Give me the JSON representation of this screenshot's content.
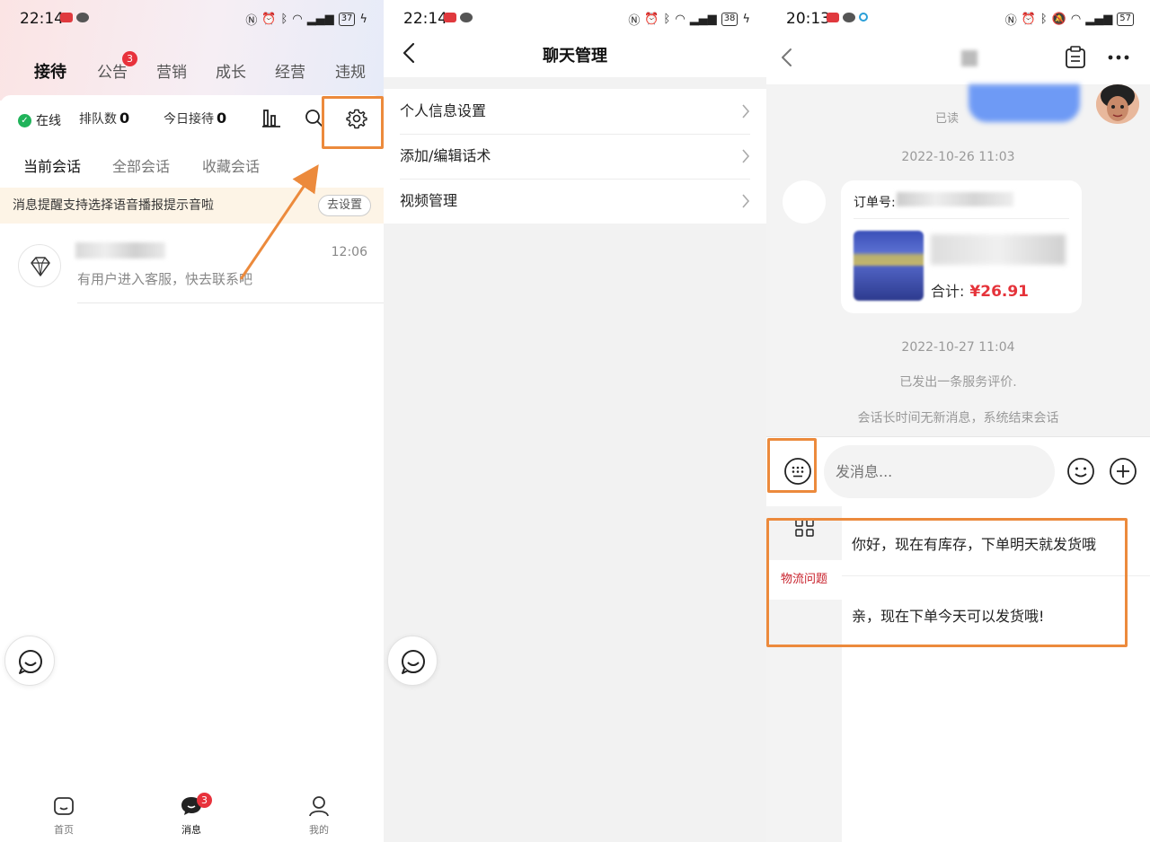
{
  "screen1": {
    "status": {
      "time": "22:14",
      "battery": "37"
    },
    "top_tabs": [
      {
        "label": "接待"
      },
      {
        "label": "公告",
        "badge": "3"
      },
      {
        "label": "营销"
      },
      {
        "label": "成长"
      },
      {
        "label": "经营"
      },
      {
        "label": "违规"
      }
    ],
    "online_label": "在线",
    "queue_label": "排队数",
    "queue_value": "0",
    "today_label": "今日接待",
    "today_value": "0",
    "sub_tabs": [
      "当前会话",
      "全部会话",
      "收藏会话"
    ],
    "notice": {
      "text": "消息提醒支持选择语音播报提示音啦",
      "button": "去设置"
    },
    "conversation": {
      "time": "12:06",
      "message": "有用户进入客服，快去联系吧"
    },
    "bottom_nav": [
      {
        "label": "首页",
        "icon": "home-icon"
      },
      {
        "label": "消息",
        "icon": "message-icon",
        "badge": "3"
      },
      {
        "label": "我的",
        "icon": "user-icon"
      }
    ]
  },
  "screen2": {
    "status": {
      "time": "22:14",
      "battery": "38"
    },
    "title": "聊天管理",
    "menu": [
      "个人信息设置",
      "添加/编辑话术",
      "视频管理"
    ]
  },
  "screen3": {
    "status": {
      "time": "20:13",
      "battery": "57"
    },
    "read_label": "已读",
    "timestamp1": "2022-10-26 11:03",
    "order_label": "订单号:",
    "order_total_label": "合计:",
    "order_total_value": "¥26.91",
    "timestamp2": "2022-10-27 11:04",
    "system_msg1": "已发出一条服务评价.",
    "system_msg2": "会话长时间无新消息，系统结束会话",
    "input_placeholder": "发消息...",
    "quick_category": "物流问题",
    "quick_replies": [
      "你好，现在有库存，下单明天就发货哦",
      "亲，现在下单今天可以发货哦!"
    ]
  },
  "colors": {
    "highlight": "#ec8a3c",
    "badge": "#e8323c",
    "price": "#e5333a",
    "online": "#20b35a"
  }
}
